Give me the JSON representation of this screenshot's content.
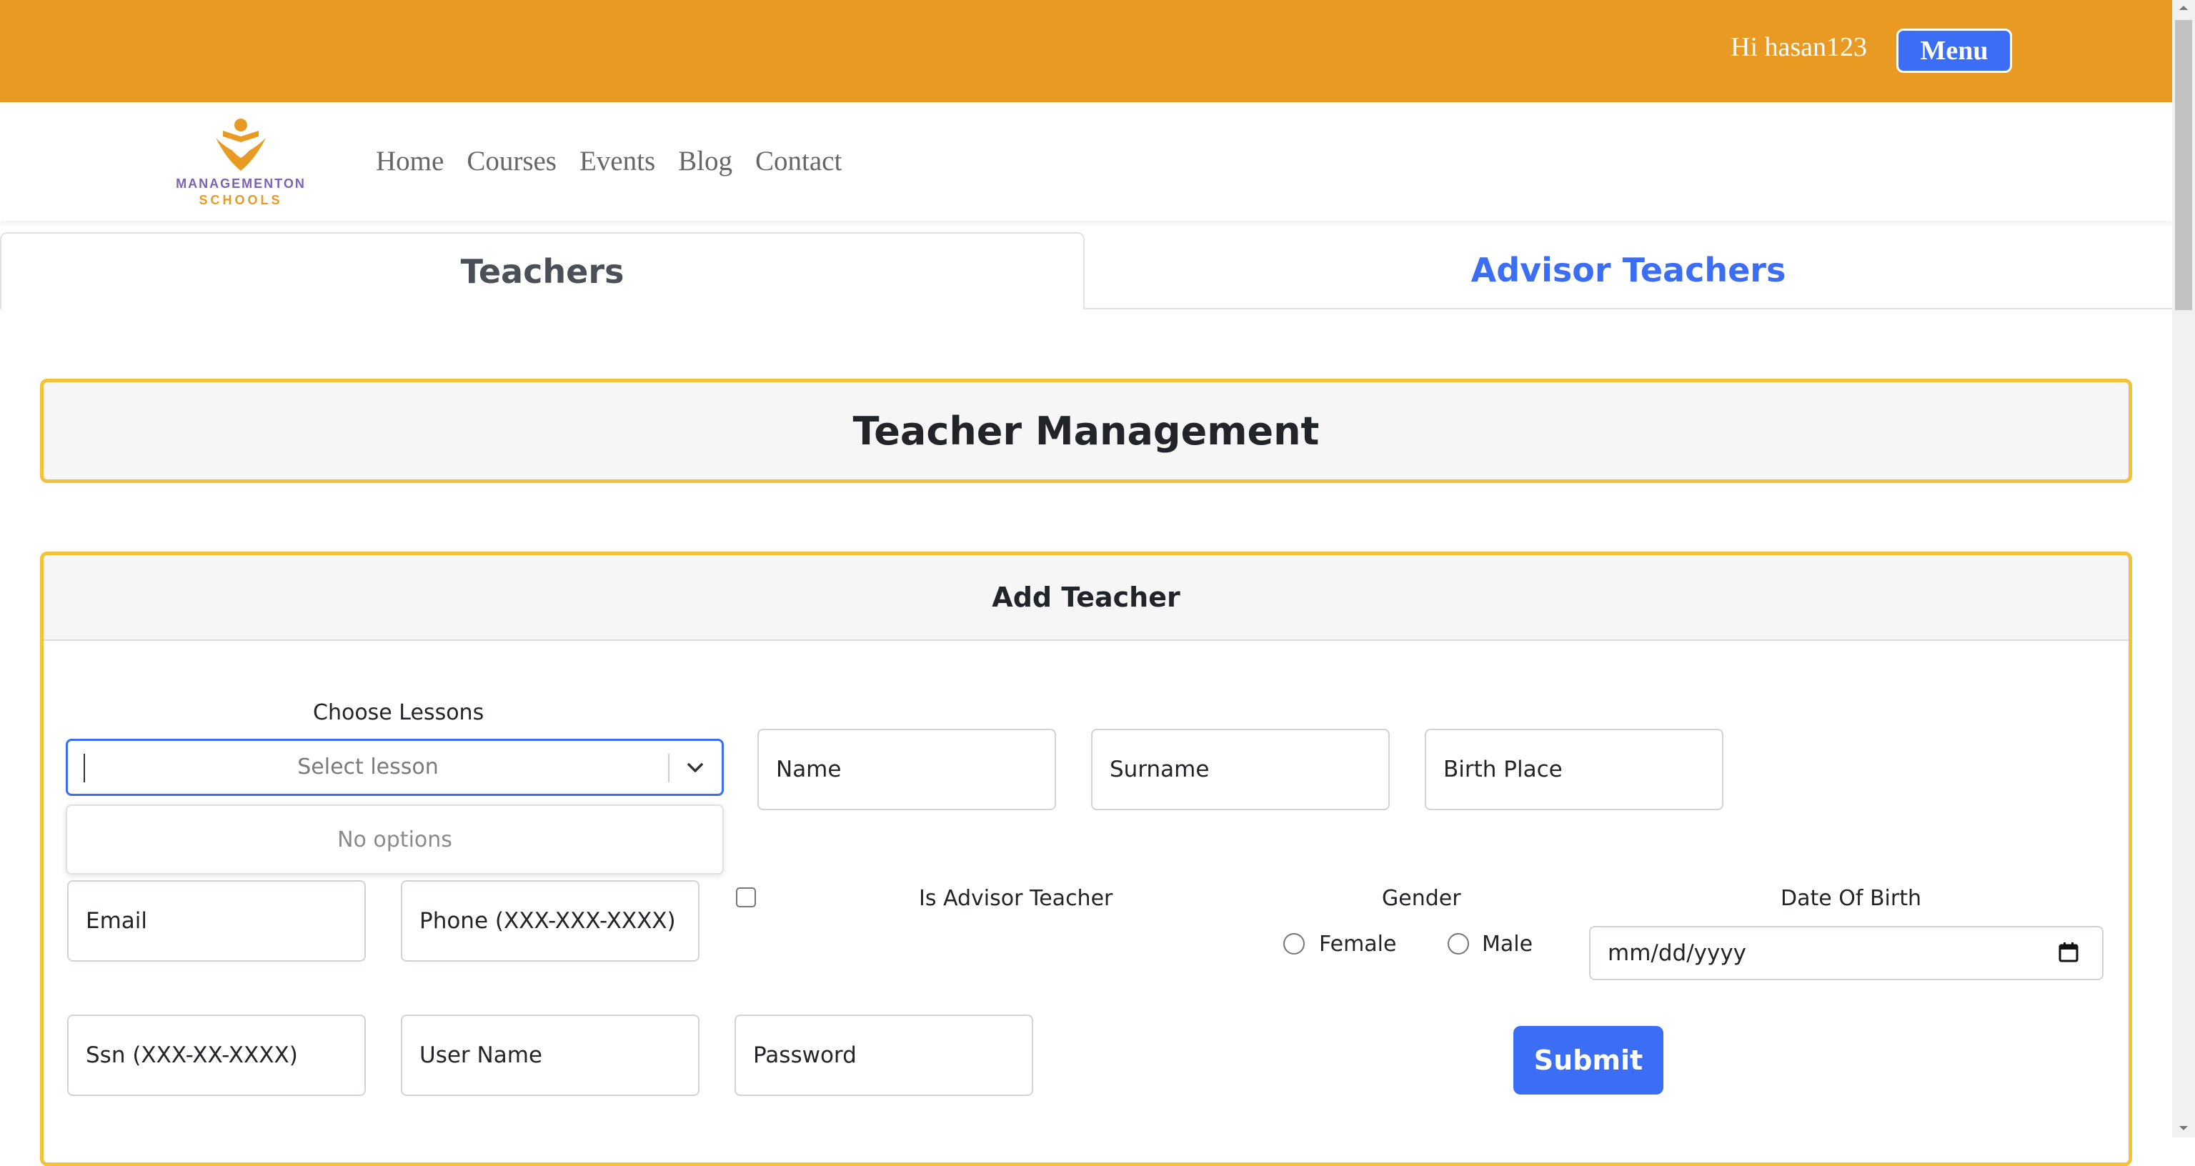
{
  "topbar": {
    "greeting": "Hi hasan123",
    "menu_label": "Menu",
    "bg_color": "#e99a23"
  },
  "logo": {
    "line1": "MANAGEMENTON",
    "line2": "SCHOOLS",
    "icon": "school-logo-icon"
  },
  "nav": {
    "items": [
      "Home",
      "Courses",
      "Events",
      "Blog",
      "Contact"
    ]
  },
  "tabs": [
    {
      "label": "Teachers",
      "active": true
    },
    {
      "label": "Advisor Teachers",
      "active": false
    }
  ],
  "page_title": "Teacher Management",
  "form": {
    "title": "Add Teacher",
    "lessons": {
      "label": "Choose Lessons",
      "placeholder": "Select lesson",
      "no_options": "No options"
    },
    "name_placeholder": "Name",
    "surname_placeholder": "Surname",
    "birth_place_placeholder": "Birth Place",
    "email_placeholder": "Email",
    "phone_placeholder": "Phone (XXX-XXX-XXXX)",
    "advisor_label": "Is Advisor Teacher",
    "gender": {
      "label": "Gender",
      "female": "Female",
      "male": "Male"
    },
    "dob": {
      "label": "Date Of Birth",
      "placeholder": "mm/dd/yyyy"
    },
    "ssn_placeholder": "Ssn (XXX-XX-XXXX)",
    "username_placeholder": "User Name",
    "password_placeholder": "Password",
    "submit_label": "Submit"
  },
  "colors": {
    "accent": "#3b6df5",
    "border_highlight": "#f3c13a"
  }
}
